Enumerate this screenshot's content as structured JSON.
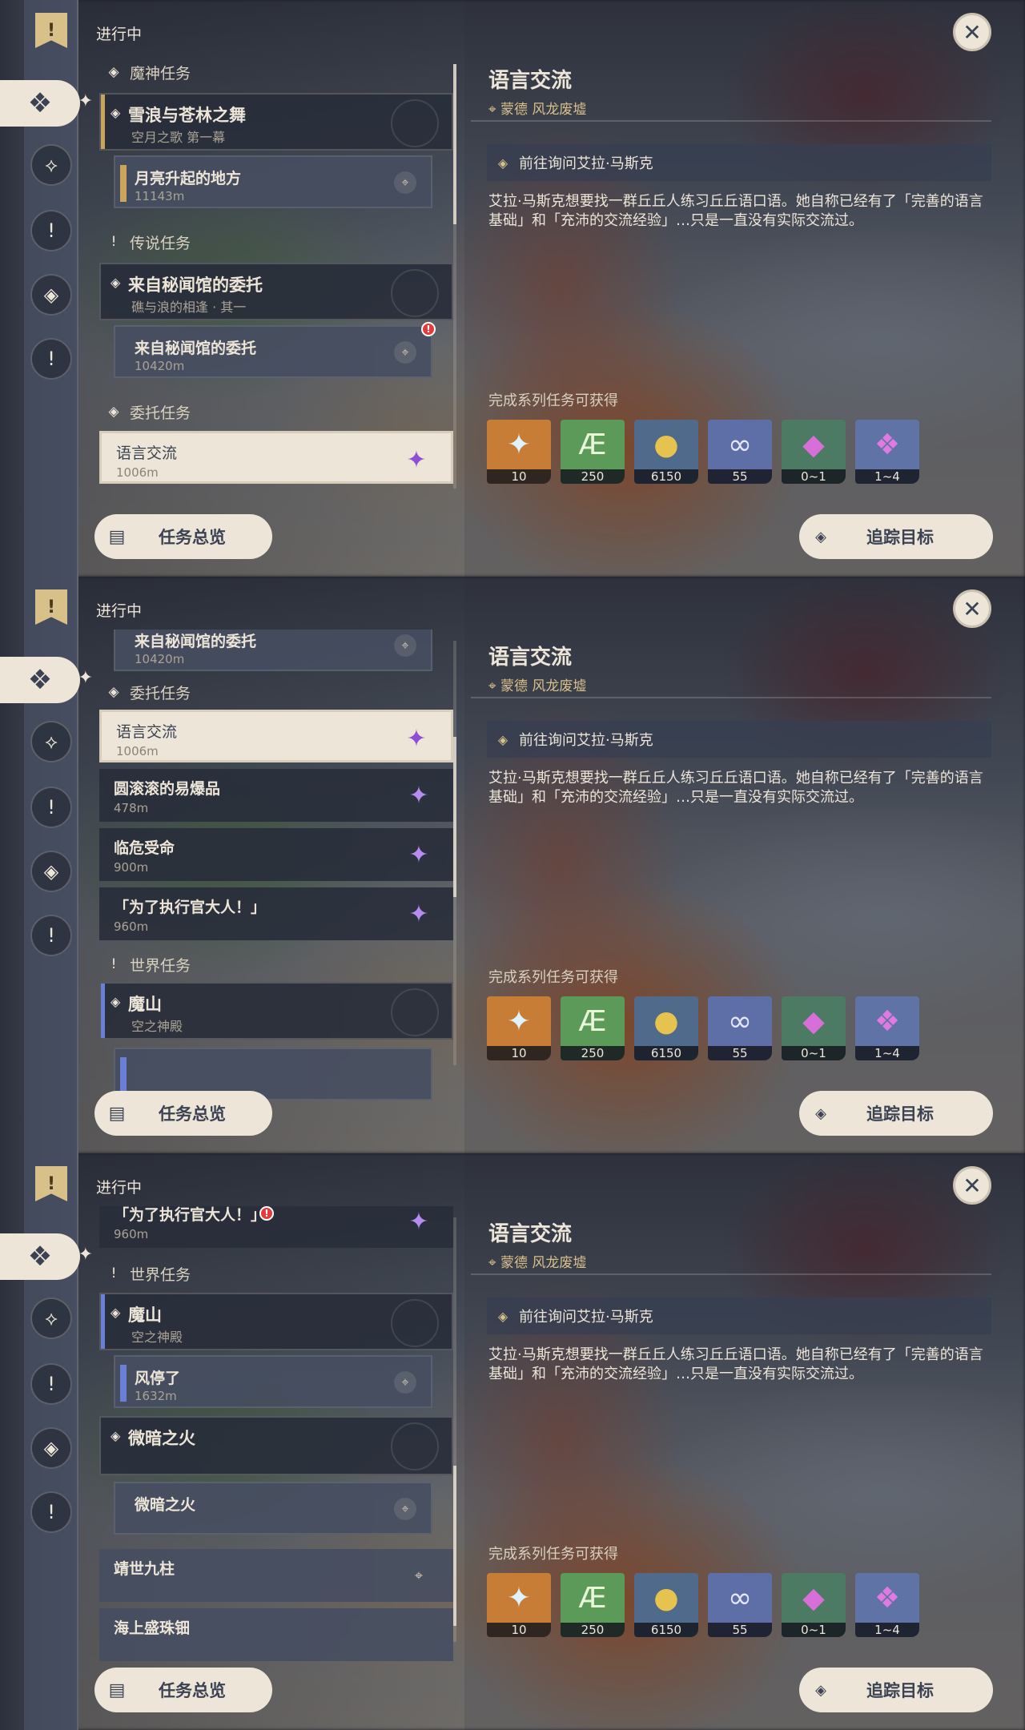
{
  "sidebar": {
    "icons": [
      "quest-bookmark-icon",
      "commission-icon",
      "archon-icon",
      "story-icon",
      "world-icon",
      "exclamation-icon"
    ]
  },
  "header": {
    "in_progress": "进行中"
  },
  "close_label": "✕",
  "footer": {
    "overview": "任务总览",
    "track": "追踪目标"
  },
  "detail": {
    "title": "语言交流",
    "location": "蒙德 风龙废墟",
    "objective": "前往询问艾拉·马斯克",
    "description": "艾拉·马斯克想要找一群丘丘人练习丘丘语口语。她自称已经有了「完善的语言基础」和「充沛的交流经验」…只是一直没有实际交流过。",
    "reward_label": "完成系列任务可获得",
    "rewards": [
      {
        "name": "primogem-icon",
        "count": "10",
        "color": "#c77d35"
      },
      {
        "name": "adventure-exp-icon",
        "count": "250",
        "color": "#5c9a5a"
      },
      {
        "name": "mora-icon",
        "count": "6150",
        "color": "#4f6a8a"
      },
      {
        "name": "companionship-icon",
        "count": "55",
        "color": "#5e6fa8"
      },
      {
        "name": "crystal-icon",
        "count": "0~1",
        "color": "#4d7a62"
      },
      {
        "name": "crystal-cluster-icon",
        "count": "1~4",
        "color": "#5f73a6"
      }
    ]
  },
  "panels": [
    {
      "cats": [
        {
          "label": "魔神任务",
          "top": 0
        },
        {
          "label": "传说任务",
          "top": 0
        },
        {
          "label": "委托任务",
          "top": 0
        }
      ],
      "archon_head": {
        "title": "雪浪与苍林之舞",
        "sub": "空月之歌 第一幕"
      },
      "archon_sub": {
        "title": "月亮升起的地方",
        "dist": "11143m"
      },
      "story_head": {
        "title": "来自秘闻馆的委托",
        "sub": "礁与浪的相逢 · 其一"
      },
      "story_sub": {
        "title": "来自秘闻馆的委托",
        "dist": "10420m"
      },
      "comm_selected": {
        "title": "语言交流",
        "dist": "1006m"
      }
    },
    {
      "story_sub": {
        "title": "来自秘闻馆的委托",
        "dist": "10420m"
      },
      "cat_comm": "委托任务",
      "comms": [
        {
          "title": "语言交流",
          "dist": "1006m"
        },
        {
          "title": "圆滚滚的易爆品",
          "dist": "478m"
        },
        {
          "title": "临危受命",
          "dist": "900m"
        },
        {
          "title": "「为了执行官大人！」",
          "dist": "960m"
        }
      ],
      "cat_world": "世界任务",
      "world_head": {
        "title": "魔山",
        "sub": "空之神殿"
      }
    },
    {
      "comm_last": {
        "title": "「为了执行官大人！」",
        "dist": "960m"
      },
      "cat_world": "世界任务",
      "world_head": {
        "title": "魔山",
        "sub": "空之神殿"
      },
      "world_sub": {
        "title": "风停了",
        "dist": "1632m"
      },
      "fire_head": {
        "title": "微暗之火"
      },
      "fire_sub": {
        "title": "微暗之火"
      },
      "nine": {
        "title": "靖世九柱"
      },
      "sea": {
        "title": "海上盛珠钿"
      }
    }
  ]
}
